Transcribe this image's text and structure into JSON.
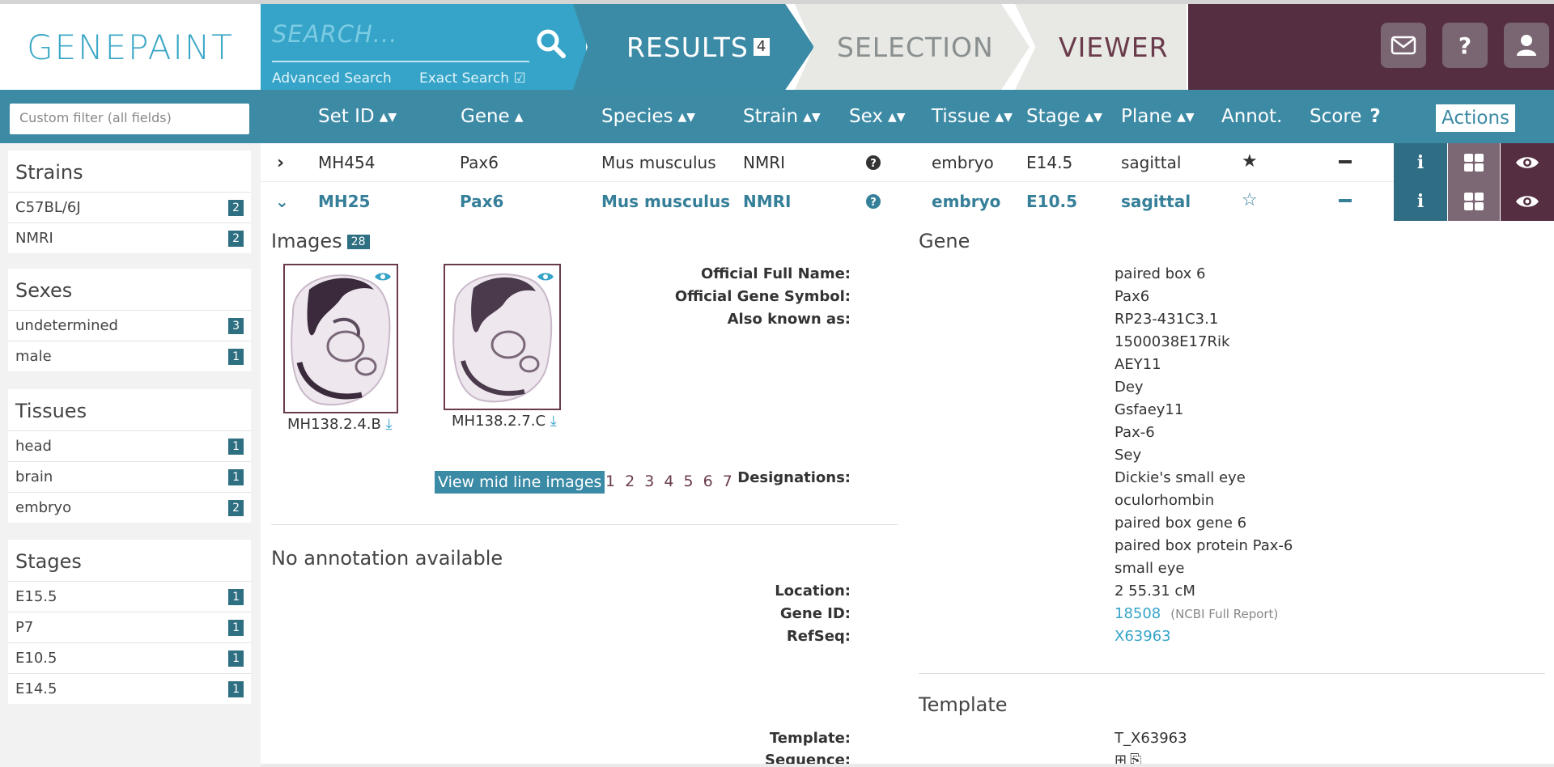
{
  "app": {
    "logo": "GENEPAINT"
  },
  "search": {
    "placeholder": "SEARCH...",
    "advanced": "Advanced Search",
    "exact": "Exact Search"
  },
  "tabs": {
    "results": "RESULTS",
    "results_count": "4",
    "selection": "SELECTION",
    "viewer": "VIEWER"
  },
  "header_icons": [
    "mail-icon",
    "help-icon",
    "user-icon"
  ],
  "filter": {
    "placeholder": "Custom filter (all fields)"
  },
  "columns": [
    "Set ID",
    "Gene",
    "Species",
    "Strain",
    "Sex",
    "Tissue",
    "Stage",
    "Plane",
    "Annot.",
    "Score",
    "Actions"
  ],
  "sidebar": {
    "strains": {
      "title": "Strains",
      "items": [
        {
          "label": "C57BL/6J",
          "count": "2"
        },
        {
          "label": "NMRI",
          "count": "2"
        }
      ]
    },
    "sexes": {
      "title": "Sexes",
      "items": [
        {
          "label": "undetermined",
          "count": "3"
        },
        {
          "label": "male",
          "count": "1"
        }
      ]
    },
    "tissues": {
      "title": "Tissues",
      "items": [
        {
          "label": "head",
          "count": "1"
        },
        {
          "label": "brain",
          "count": "1"
        },
        {
          "label": "embryo",
          "count": "2"
        }
      ]
    },
    "stages": {
      "title": "Stages",
      "items": [
        {
          "label": "E15.5",
          "count": "1"
        },
        {
          "label": "P7",
          "count": "1"
        },
        {
          "label": "E10.5",
          "count": "1"
        },
        {
          "label": "E14.5",
          "count": "1"
        }
      ]
    }
  },
  "rows": [
    {
      "set_id": "MH454",
      "gene": "Pax6",
      "species": "Mus musculus",
      "strain": "NMRI",
      "tissue": "embryo",
      "stage": "E14.5",
      "plane": "sagittal",
      "annotated": true
    },
    {
      "set_id": "MH25",
      "gene": "Pax6",
      "species": "Mus musculus",
      "strain": "NMRI",
      "tissue": "embryo",
      "stage": "E10.5",
      "plane": "sagittal",
      "annotated": false
    }
  ],
  "details": {
    "images_title": "Images",
    "images_count": "28",
    "images": [
      {
        "caption": "MH138.2.4.B"
      },
      {
        "caption": "MH138.2.7.C"
      }
    ],
    "mid_line_button": "View mid line images",
    "pages": "1 2 3 4 5 6 7",
    "annotation": "No annotation available",
    "gene_title": "Gene",
    "gene": {
      "official_full_name_label": "Official Full Name:",
      "official_full_name": "paired box 6",
      "symbol_label": "Official Gene Symbol:",
      "symbol": "Pax6",
      "aka_label": "Also known as:",
      "aka": [
        "RP23-431C3.1",
        "1500038E17Rik",
        "AEY11",
        "Dey",
        "Gsfaey11",
        "Pax-6",
        "Sey"
      ],
      "designations_label": "Designations:",
      "designations": [
        "Dickie's small eye",
        "oculorhombin",
        "paired box gene 6",
        "paired box protein Pax-6",
        "small eye"
      ],
      "location_label": "Location:",
      "location": "2 55.31 cM",
      "gene_id_label": "Gene ID:",
      "gene_id": "18508",
      "ncbi": "(NCBI Full Report)",
      "refseq_label": "RefSeq:",
      "refseq": "X63963"
    },
    "template_title": "Template",
    "template": {
      "template_label": "Template:",
      "template": "T_X63963",
      "sequence_label": "Sequence:"
    }
  },
  "colors": {
    "accent": "#35a4c8",
    "tab": "#3b8aa6",
    "dark": "#552e42",
    "badge": "#2e6f82"
  }
}
